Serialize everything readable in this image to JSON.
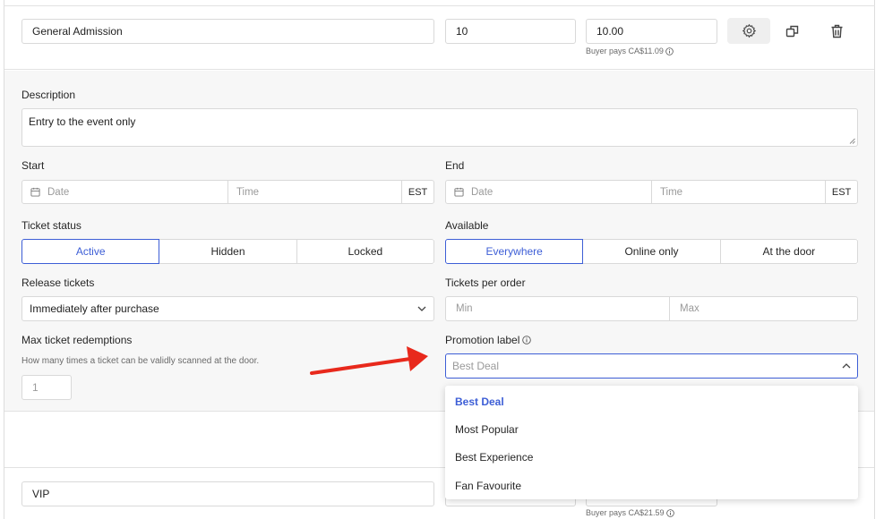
{
  "ticket": {
    "name": "General Admission",
    "quantity": "10",
    "price": "10.00",
    "buyer_pays": "Buyer pays CA$11.09"
  },
  "description": {
    "label": "Description",
    "value": "Entry to the event only"
  },
  "start": {
    "label": "Start",
    "date_placeholder": "Date",
    "time_placeholder": "Time",
    "tz": "EST"
  },
  "end": {
    "label": "End",
    "date_placeholder": "Date",
    "time_placeholder": "Time",
    "tz": "EST"
  },
  "ticket_status": {
    "label": "Ticket status",
    "options": [
      "Active",
      "Hidden",
      "Locked"
    ],
    "selected": "Active"
  },
  "available": {
    "label": "Available",
    "options": [
      "Everywhere",
      "Online only",
      "At the door"
    ],
    "selected": "Everywhere"
  },
  "release": {
    "label": "Release tickets",
    "value": "Immediately after purchase"
  },
  "per_order": {
    "label": "Tickets per order",
    "min_placeholder": "Min",
    "max_placeholder": "Max"
  },
  "max_redemptions": {
    "label": "Max ticket redemptions",
    "hint": "How many times a ticket can be validly scanned at the door.",
    "placeholder": "1"
  },
  "promotion": {
    "label": "Promotion label",
    "placeholder": "Best Deal",
    "options": [
      "Best Deal",
      "Most Popular",
      "Best Experience",
      "Fan Favourite"
    ],
    "selected": "Best Deal"
  },
  "vip_ticket": {
    "name": "VIP",
    "buyer_pays": "Buyer pays CA$21.59"
  },
  "colors": {
    "accent": "#3d5ed6",
    "arrow": "#e8291c"
  }
}
